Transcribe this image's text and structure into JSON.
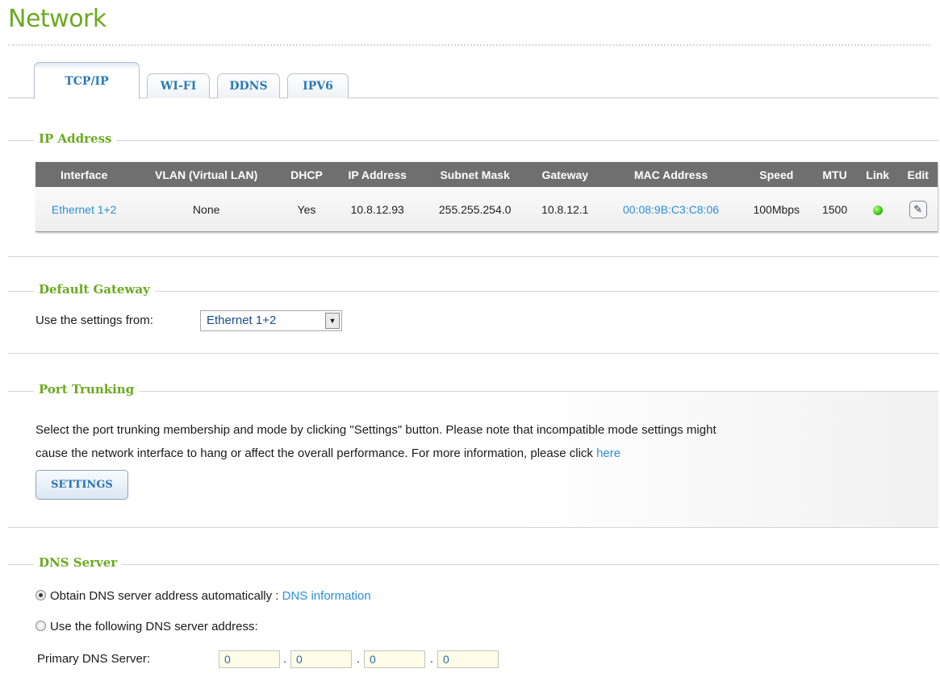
{
  "page": {
    "title": "Network"
  },
  "tabs": [
    {
      "label": "TCP/IP",
      "active": true
    },
    {
      "label": "WI-FI",
      "active": false
    },
    {
      "label": "DDNS",
      "active": false
    },
    {
      "label": "IPV6",
      "active": false
    }
  ],
  "ip_address": {
    "legend": "IP Address",
    "columns": [
      "Interface",
      "VLAN (Virtual LAN)",
      "DHCP",
      "IP Address",
      "Subnet Mask",
      "Gateway",
      "MAC Address",
      "Speed",
      "MTU",
      "Link",
      "Edit"
    ],
    "rows": [
      {
        "interface": "Ethernet 1+2",
        "vlan": "None",
        "dhcp": "Yes",
        "ip": "10.8.12.93",
        "subnet": "255.255.254.0",
        "gateway": "10.8.12.1",
        "mac": "00:08:9B:C3:C8:06",
        "speed": "100Mbps",
        "mtu": "1500",
        "link_icon": "green-led-icon",
        "edit_icon": "edit-pencil-icon"
      }
    ]
  },
  "default_gateway": {
    "legend": "Default Gateway",
    "label": "Use the settings from:",
    "selected": "Ethernet 1+2"
  },
  "port_trunking": {
    "legend": "Port Trunking",
    "line1": "Select the port trunking membership and mode by clicking \"Settings\" button. Please note that incompatible mode settings might",
    "line2": "cause the network interface to hang or affect the overall performance. For more information, please click",
    "link": "here",
    "button": "SETTINGS"
  },
  "dns_server": {
    "legend": "DNS Server",
    "option_auto": "Obtain DNS server address automatically",
    "separator": ":",
    "info_link": "DNS information",
    "option_manual": "Use the following DNS server address:",
    "primary_label": "Primary DNS Server:",
    "primary_octets": [
      "0",
      "0",
      "0",
      "0"
    ],
    "dot": "."
  },
  "colors": {
    "accent_green": "#6aaa1f",
    "link_blue": "#2b8fd6",
    "header_gray": "#6f6f6f"
  }
}
